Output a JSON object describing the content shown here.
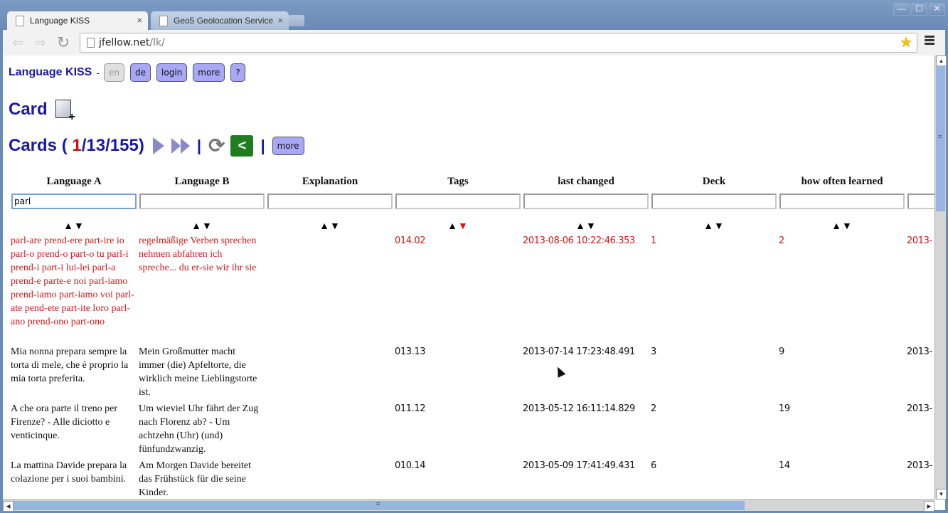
{
  "window": {
    "controls": {
      "minimize": "—",
      "maximize": "☐",
      "close": "✕"
    }
  },
  "tabs": [
    {
      "label": "Language KISS",
      "close": "×",
      "active": true
    },
    {
      "label": "Geo5 Geolocation Service",
      "close": "×",
      "active": false
    }
  ],
  "toolbar": {
    "back": "⇦",
    "forward": "⇨",
    "reload": "↻",
    "url_host": "jfellow.net",
    "url_path": "/lk/",
    "bookmark_icon": "★"
  },
  "page": {
    "brand": "Language KISS",
    "dash": "-",
    "nav_buttons": [
      {
        "label": "en",
        "disabled": true
      },
      {
        "label": "de",
        "disabled": false
      },
      {
        "label": "login",
        "disabled": false
      },
      {
        "label": "more",
        "disabled": false
      },
      {
        "label": "?",
        "disabled": false
      }
    ],
    "card_heading": "Card",
    "cards": {
      "prefix": "Cards (",
      "current": "1",
      "sep1": " / ",
      "filtered": "13",
      "sep2": " / ",
      "total": "155",
      "suffix": " )",
      "separator": "|",
      "refresh_icon": "⟳",
      "share_icon": "<",
      "more_label": "more"
    }
  },
  "table": {
    "columns": [
      {
        "header": "Language A",
        "filter": "parl",
        "sort_active": null
      },
      {
        "header": "Language B",
        "filter": "",
        "sort_active": null
      },
      {
        "header": "Explanation",
        "filter": "",
        "sort_active": null
      },
      {
        "header": "Tags",
        "filter": "",
        "sort_active": "desc"
      },
      {
        "header": "last changed",
        "filter": "",
        "sort_active": null
      },
      {
        "header": "Deck",
        "filter": "",
        "sort_active": null
      },
      {
        "header": "how often learned",
        "filter": "",
        "sort_active": null
      }
    ],
    "sort_up": "▲",
    "sort_down": "▼",
    "rows": [
      {
        "highlight": true,
        "lang_a": "parl-are prend-ere part-ire io parl-o prend-o part-o tu parl-i prend-i part-i lui-lei parl-a prend-e parte-e noi parl-iamo prend-iamo part-iamo voi parl-ate pend-ete part-ite loro parl-ano prend-ono part-ono",
        "lang_b": "regelmäßige Verben sprechen nehmen abfahren ich spreche... du er-sie wir ihr sie",
        "explanation": "",
        "tags": "014.02",
        "last_changed": "2013-08-06 10:22:46.353",
        "deck": "1",
        "learned": "2",
        "next": "2013-"
      },
      {
        "highlight": false,
        "lang_a": "Mia nonna prepara sempre la torta di mele, che è proprio la mia torta preferita.",
        "lang_b": "Mein Großmutter macht immer (die) Apfeltorte, die wirklich meine Lieblingstorte ist.",
        "explanation": "",
        "tags": "013.13",
        "last_changed": "2013-07-14 17:23:48.491",
        "deck": "3",
        "learned": "9",
        "next": "2013-"
      },
      {
        "highlight": false,
        "lang_a": "A che ora parte il treno per Firenze? - Alle diciotto e venticinque.",
        "lang_b": "Um wieviel Uhr fährt der Zug nach Florenz ab? - Um achtzehn (Uhr) (und) fünfundzwanzig.",
        "explanation": "",
        "tags": "011.12",
        "last_changed": "2013-05-12 16:11:14.829",
        "deck": "2",
        "learned": "19",
        "next": "2013-"
      },
      {
        "highlight": false,
        "lang_a": "La mattina Davide prepara la colazione per i suoi bambini.",
        "lang_b": "Am Morgen Davide bereitet das Frühstück für die seine Kinder.",
        "explanation": "",
        "tags": "010.14",
        "last_changed": "2013-05-09 17:41:49.431",
        "deck": "6",
        "learned": "14",
        "next": "2013-"
      }
    ]
  },
  "scrollbars": {
    "up": "▲",
    "down": "▼",
    "left": "◀",
    "right": "▶",
    "grip": "≡"
  }
}
